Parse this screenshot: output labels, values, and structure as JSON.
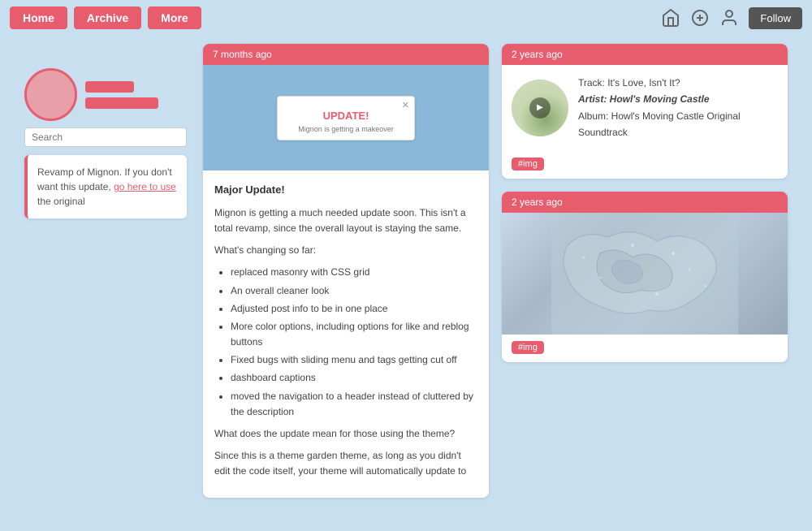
{
  "header": {
    "nav": [
      {
        "label": "Home",
        "key": "home"
      },
      {
        "label": "Archive",
        "key": "archive"
      },
      {
        "label": "More",
        "key": "more"
      }
    ],
    "icons": [
      "home-icon",
      "add-icon",
      "user-icon"
    ],
    "follow_label": "Follow"
  },
  "sidebar": {
    "search_placeholder": "Search",
    "notice_text": "Revamp of Mignon. If you don't want this update,",
    "notice_link_text": "go here to use",
    "notice_link_suffix": " the original"
  },
  "posts": {
    "left_column": {
      "post1": {
        "age": "7 months ago",
        "screenshot_title": "UPDATE!",
        "screenshot_subtitle": "Mignon is getting a makeover",
        "body_heading": "Major Update!",
        "body_para1": "Mignon is getting a much needed update soon. This isn't a total revamp, since the overall layout is staying the same.",
        "whats_changing": "What's changing so far:",
        "changes": [
          "replaced masonry with CSS grid",
          "An overall cleaner look",
          "Adjusted post info to be in one place",
          "More color options, including options for like and reblog buttons",
          "Fixed bugs with sliding menu and tags getting cut off",
          "dashboard captions",
          "moved the navigation to a header instead of cluttered by the description"
        ],
        "question": "What does the update mean for those using the theme?",
        "answer": "Since this is a theme garden theme, as long as you didn't edit the code itself, your theme will automatically update to"
      }
    },
    "right_column": {
      "post1": {
        "age": "2 years ago",
        "track": "Track: It's Love, Isn't It?",
        "artist": "Artist: Howl's Moving Castle",
        "album": "Album: Howl's Moving Castle Original Soundtrack",
        "tag": "#img"
      },
      "post2": {
        "age": "2 years ago",
        "tag": "#img"
      }
    }
  }
}
